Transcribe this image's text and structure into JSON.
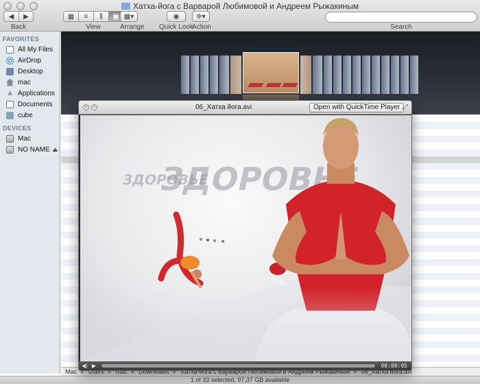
{
  "window": {
    "title": "Хатха-йога с Варварой Любимовой и Андреем Рыжакиным"
  },
  "toolbar": {
    "back_label": "Back",
    "view_label": "View",
    "arrange_label": "Arrange",
    "quicklook_label": "Quick Look",
    "action_label": "Action",
    "search_label": "Search",
    "search_placeholder": ""
  },
  "sidebar": {
    "favorites_heading": "FAVORITES",
    "favorites": [
      {
        "label": "All My Files",
        "icon": "all-files-icon"
      },
      {
        "label": "AirDrop",
        "icon": "airdrop-icon"
      },
      {
        "label": "Desktop",
        "icon": "desktop-icon"
      },
      {
        "label": "mac",
        "icon": "home-icon"
      },
      {
        "label": "Applications",
        "icon": "applications-icon"
      },
      {
        "label": "Documents",
        "icon": "documents-icon"
      },
      {
        "label": "cube",
        "icon": "folder-icon"
      }
    ],
    "devices_heading": "DEVICES",
    "devices": [
      {
        "label": "Mac",
        "icon": "disk-icon"
      },
      {
        "label": "NO NAME",
        "icon": "disk-icon"
      }
    ]
  },
  "quicklook": {
    "filename": "06_Хатха йога.avi",
    "open_button": "Open with QuickTime Player",
    "time": "00:00:05",
    "video_text": [
      "ЗДОРОВЬЕ",
      "ЗДОРОВЬЕ"
    ]
  },
  "pathbar": {
    "crumbs": [
      "Mac",
      "Users",
      "mac",
      "Downloads",
      "Хатха-йога с Варварой Любимовой и Андреем Рыжакиным",
      "06_Хатха йога.avi"
    ]
  },
  "status": {
    "text": "1 of 33 selected, 97,37 GB available"
  },
  "colors": {
    "sidebar_bg": "#e3e8ee",
    "coverflow_bg": "#2a2e37",
    "shirt_red": "#d2232a",
    "mat_red": "#c0303a"
  }
}
